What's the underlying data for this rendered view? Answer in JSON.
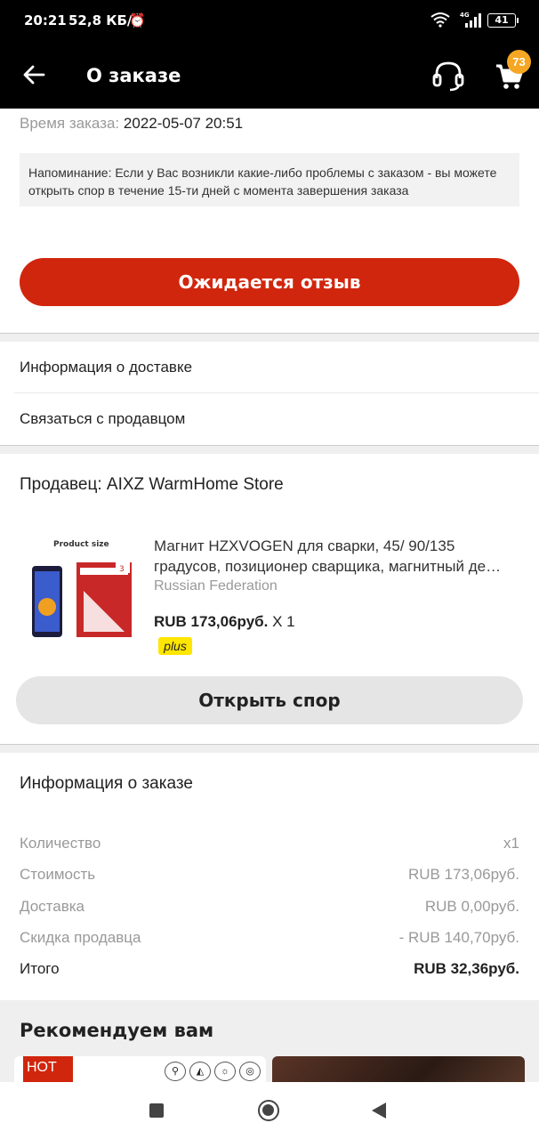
{
  "status_bar": {
    "time": "20:21",
    "speed": "52,8 КБ/с",
    "network": "4G",
    "battery": "41"
  },
  "app_bar": {
    "title": "О заказе",
    "cart_count": "73"
  },
  "order": {
    "time_label": "Время заказа:",
    "time_value": "2022-05-07 20:51",
    "reminder": "Напоминание: Если у Вас возникли какие-либо проблемы с заказом - вы можете открыть спор в течение 15-ти дней с момента завершения заказа",
    "review_button": "Ожидается отзыв"
  },
  "links": {
    "delivery_info": "Информация о доставке",
    "contact_seller": "Связаться с продавцом"
  },
  "seller": {
    "label": "Продавец: AIXZ WarmHome Store"
  },
  "product": {
    "title_line1": "Магнит HZXVOGEN для сварки, 45/ 90/135",
    "title_line2": "градусов, позиционер сварщика, магнитный де…",
    "country": "Russian Federation",
    "price": "RUB 173,06руб.",
    "quantity": "X 1",
    "plus_label": "plus",
    "image_text": "Product size",
    "dispute_button": "Открыть спор"
  },
  "order_info": {
    "title": "Информация о заказе",
    "rows": [
      {
        "label": "Количество",
        "value": "x1"
      },
      {
        "label": "Стоимость",
        "value": "RUB 173,06руб."
      },
      {
        "label": "Доставка",
        "value": "RUB 0,00руб."
      },
      {
        "label": "Скидка продавца",
        "value": "- RUB 140,70руб."
      },
      {
        "label": "Итого",
        "value": "RUB 32,36руб."
      }
    ]
  },
  "recommend": {
    "title": "Рекомендуем вам",
    "card1_badge": "HOT",
    "card1_icons": [
      "usb-icon",
      "chart-icon",
      "bulb-icon",
      "360-icon"
    ]
  },
  "colors": {
    "accent": "#d0260d",
    "badge": "#f5a623",
    "plus_yellow": "#ffe600"
  }
}
